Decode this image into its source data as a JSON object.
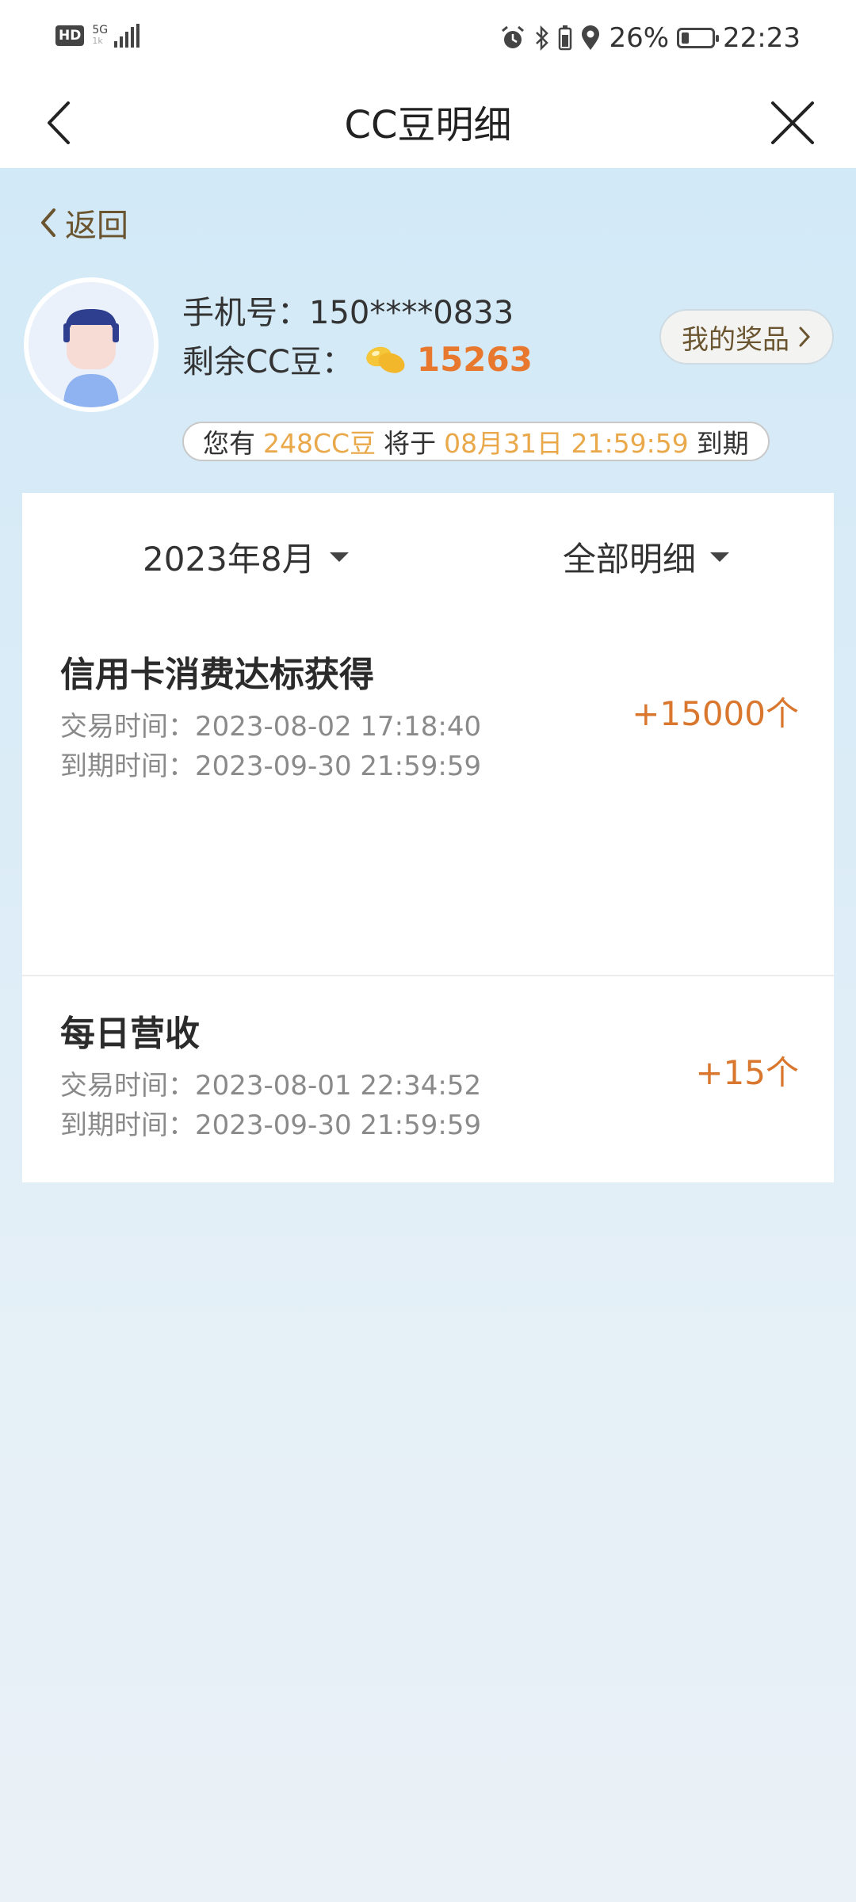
{
  "status_bar": {
    "hd": "HD",
    "network": "5G",
    "network_sub": "1k",
    "battery": "26%",
    "battery_level": 0.26,
    "time": "22:23",
    "icons": [
      "alarm-icon",
      "bluetooth-icon",
      "location-icon",
      "battery-icon",
      "signal-icon"
    ]
  },
  "nav": {
    "title": "CC豆明细"
  },
  "header": {
    "back_label": "返回",
    "phone_label": "手机号：",
    "phone_value": "150****0833",
    "beans_label": "剩余CC豆：",
    "beans_value": "15263",
    "prize_button": "我的奖品"
  },
  "expiry": {
    "prefix": "您有",
    "amount": "248CC豆",
    "middle": "将于",
    "date": "08月31日 21:59:59",
    "suffix": "到期"
  },
  "filters": {
    "month": "2023年8月",
    "type": "全部明细"
  },
  "transactions": [
    {
      "title": "信用卡消费达标获得",
      "trade_time": "交易时间：2023-08-02 17:18:40",
      "expire_time": "到期时间：2023-09-30 21:59:59",
      "amount": "+15000个"
    },
    {
      "title": "每日营收",
      "trade_time": "交易时间：2023-08-01 22:34:52",
      "expire_time": "到期时间：2023-09-30 21:59:59",
      "amount": "+15个"
    }
  ],
  "colors": {
    "accent": "#e8782e",
    "highlight": "#e9a849",
    "brown": "#6b5530",
    "background": "#d2e9f7"
  }
}
